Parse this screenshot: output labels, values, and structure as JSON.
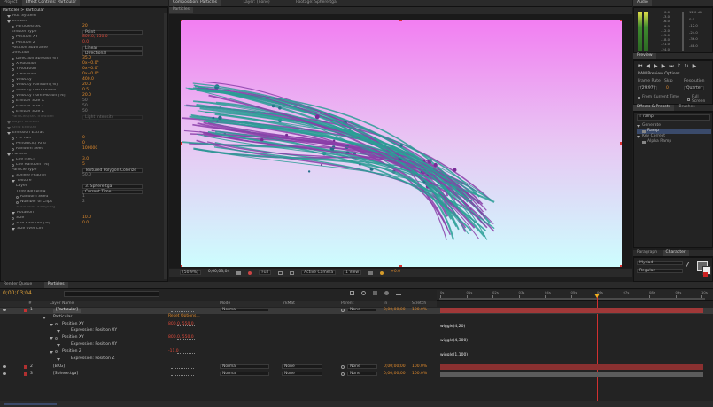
{
  "left_tabs": [
    "Project",
    "Effect Controls: Particular"
  ],
  "effect_path": "Particles > Particular",
  "effect_rows": [
    {
      "indent": 1,
      "label": "Aux System",
      "tri": true,
      "value": ""
    },
    {
      "indent": 1,
      "label": "Emitter",
      "tri": true,
      "value": ""
    },
    {
      "indent": 2,
      "label": "Particles/sec",
      "stop": true,
      "value": "20",
      "color": "orange"
    },
    {
      "indent": 2,
      "label": "Emitter Type",
      "value": "Point",
      "box": true
    },
    {
      "indent": 2,
      "label": "Position XY",
      "stop": true,
      "value": "800.0, 550.0",
      "color": "red"
    },
    {
      "indent": 2,
      "label": "Position Z",
      "stop": true,
      "value": "0.0",
      "color": "red"
    },
    {
      "indent": 2,
      "label": "Position Subframe",
      "value": "Linear",
      "box": true
    },
    {
      "indent": 2,
      "label": "Direction",
      "value": "Directional",
      "box": true
    },
    {
      "indent": 2,
      "label": "Direction Spread [%]",
      "stop": true,
      "value": "35.0",
      "color": "orange"
    },
    {
      "indent": 2,
      "label": "X Rotation",
      "stop": true,
      "value": "0x+0.0°",
      "color": "orange"
    },
    {
      "indent": 2,
      "label": "Y Rotation",
      "stop": true,
      "value": "0x+0.0°",
      "color": "orange"
    },
    {
      "indent": 2,
      "label": "Z Rotation",
      "stop": true,
      "value": "0x+0.0°",
      "color": "orange"
    },
    {
      "indent": 2,
      "label": "Velocity",
      "stop": true,
      "value": "400.0",
      "color": "orange"
    },
    {
      "indent": 2,
      "label": "Velocity Random [%]",
      "stop": true,
      "value": "20.0",
      "color": "orange"
    },
    {
      "indent": 2,
      "label": "Velocity Distribution",
      "stop": true,
      "value": "0.5",
      "color": "orange"
    },
    {
      "indent": 2,
      "label": "Velocity from Motion [%]",
      "stop": true,
      "value": "20.0",
      "color": "orange"
    },
    {
      "indent": 2,
      "label": "Emitter Size X",
      "stop": true,
      "value": "50",
      "color": "grey"
    },
    {
      "indent": 2,
      "label": "Emitter Size Y",
      "stop": true,
      "value": "50",
      "color": "grey"
    },
    {
      "indent": 2,
      "label": "Emitter Size Z",
      "stop": true,
      "value": "50",
      "color": "grey"
    },
    {
      "indent": 2,
      "label": "Particles/sec modifier",
      "value": "Light Intensity",
      "box": true,
      "dim": true
    },
    {
      "indent": 1,
      "label": "Layer Emitter",
      "tri": true,
      "value": "",
      "dim": true
    },
    {
      "indent": 1,
      "label": "Grid Emitter",
      "tri": true,
      "value": "",
      "dim": true
    },
    {
      "indent": 1,
      "label": "Emission Extras",
      "tri": true,
      "value": ""
    },
    {
      "indent": 2,
      "label": "Pre Run",
      "stop": true,
      "value": "0",
      "color": "orange"
    },
    {
      "indent": 2,
      "label": "Periodicity Rnd",
      "stop": true,
      "value": "0",
      "color": "orange"
    },
    {
      "indent": 2,
      "label": "Random Seed",
      "stop": true,
      "value": "100000",
      "color": "orange"
    },
    {
      "indent": 1,
      "label": "Particle",
      "tri": true,
      "value": ""
    },
    {
      "indent": 2,
      "label": "Life [sec]",
      "stop": true,
      "value": "3.0",
      "color": "orange"
    },
    {
      "indent": 2,
      "label": "Life Random [%]",
      "stop": true,
      "value": "5",
      "color": "orange"
    },
    {
      "indent": 2,
      "label": "Particle Type",
      "value": "Textured Polygon Colorize",
      "box": true
    },
    {
      "indent": 2,
      "label": "Sphere Feather",
      "stop": true,
      "value": "50.0",
      "color": "grey"
    },
    {
      "indent": 2,
      "label": "Texture",
      "tri": true,
      "value": ""
    },
    {
      "indent": 3,
      "label": "Layer",
      "value": "3. Sphere.tga",
      "box": true
    },
    {
      "indent": 3,
      "label": "Time Sampling",
      "value": "Current Time",
      "box": true
    },
    {
      "indent": 3,
      "label": "Random Seed",
      "stop": true,
      "value": "1",
      "color": "grey"
    },
    {
      "indent": 3,
      "label": "Number of Clips",
      "stop": true,
      "value": "2",
      "color": "grey"
    },
    {
      "indent": 3,
      "label": "Subframe Sampling",
      "value": "",
      "dim": true
    },
    {
      "indent": 2,
      "label": "Rotation",
      "tri": true,
      "value": ""
    },
    {
      "indent": 2,
      "label": "Size",
      "stop": true,
      "value": "10.0",
      "color": "orange"
    },
    {
      "indent": 2,
      "label": "Size Random [%]",
      "stop": true,
      "value": "0.0",
      "color": "orange"
    },
    {
      "indent": 2,
      "label": "Size over Life",
      "tri": true,
      "value": ""
    }
  ],
  "comp": {
    "tabs": [
      "Composition: Particles",
      "Layer: (none)",
      "Footage: Sphere.tga"
    ],
    "breadcrumb": "Particles",
    "status": [
      "(50.9%)",
      "0;00;03;04",
      "Full",
      "Active Camera",
      "1 View",
      "+0.0"
    ]
  },
  "audio": {
    "title": "Audio",
    "left_scale": [
      "0.0",
      "-3.0",
      "-6.0",
      "-9.0",
      "-12.0",
      "-15.0",
      "-18.0",
      "-21.0",
      "-24.0"
    ],
    "right_scale": [
      "12.0 dB",
      "0.0",
      "-12.0",
      "-24.0",
      "-36.0",
      "-48.0"
    ]
  },
  "preview": {
    "title": "Preview",
    "options_label": "RAM Preview Options",
    "frame_rate_label": "Frame Rate",
    "skip_label": "Skip",
    "resolution_label": "Resolution",
    "frame_rate_value": "(29.97)",
    "skip_value": "0",
    "resolution_value": "Quarter",
    "from_current": "From Current Time",
    "full_screen": "Full Screen"
  },
  "effects": {
    "tabs": [
      "Effects & Presets",
      "Brushes"
    ],
    "search": "ramp",
    "tree": [
      {
        "label": "Generate",
        "indent": 0
      },
      {
        "label": "Ramp",
        "indent": 1,
        "selected": true
      },
      {
        "label": "Key Correct",
        "indent": 0
      },
      {
        "label": "Alpha Ramp",
        "indent": 1
      }
    ]
  },
  "character": {
    "tabs": [
      "Paragraph",
      "Character"
    ],
    "font": "Myriad",
    "style": "Regular"
  },
  "timeline": {
    "tabs": [
      "Render Queue",
      "Particles"
    ],
    "timecode": "0;00;03;04",
    "search_placeholder": "",
    "columns": [
      "#",
      "Source Name",
      "Mode",
      "T",
      "TrkMat",
      "Parent",
      "In",
      "Stretch"
    ],
    "ruler": [
      "0s",
      "01s",
      "02s",
      "03s",
      "04s",
      "05s",
      "06s",
      "07s",
      "08s",
      "09s",
      "10s"
    ],
    "header_label": "Layer Name",
    "switches_label": "Reset   Options...",
    "layers": [
      {
        "num": "1",
        "name": "[Particular]",
        "mode": "Normal",
        "trkmat": "",
        "parent": "None",
        "in": "0;00;00;00",
        "stretch": "100.0%",
        "selected": true
      },
      {
        "num": "",
        "name": "Particular",
        "sub": true,
        "indent": 1
      },
      {
        "num": "",
        "name": "Position XY",
        "sub": true,
        "indent": 2,
        "value": "800.0, 550.0",
        "vcolor": "red"
      },
      {
        "num": "",
        "name": "Expression: Position XY",
        "sub": true,
        "indent": 3
      },
      {
        "num": "",
        "name": "Position XY",
        "sub": true,
        "indent": 2,
        "value": "800.0, 550.0",
        "vcolor": "red"
      },
      {
        "num": "",
        "name": "Expression: Position XY",
        "sub": true,
        "indent": 3
      },
      {
        "num": "",
        "name": "Position Z",
        "sub": true,
        "indent": 2,
        "value": "-11.0",
        "vcolor": "red"
      },
      {
        "num": "",
        "name": "Expression: Position Z",
        "sub": true,
        "indent": 3
      },
      {
        "num": "2",
        "name": "[BKG]",
        "mode": "Normal",
        "trkmat": "None",
        "parent": "None",
        "in": "0;00;00;00",
        "stretch": "100.0%"
      },
      {
        "num": "3",
        "name": "[Sphere.tga]",
        "mode": "Normal",
        "trkmat": "None",
        "parent": "None",
        "in": "0;00;00;00",
        "stretch": "100.0%"
      }
    ],
    "expressions": [
      "wiggle(4,20)",
      "wiggle(4,300)",
      "wiggle(1,100)"
    ]
  }
}
